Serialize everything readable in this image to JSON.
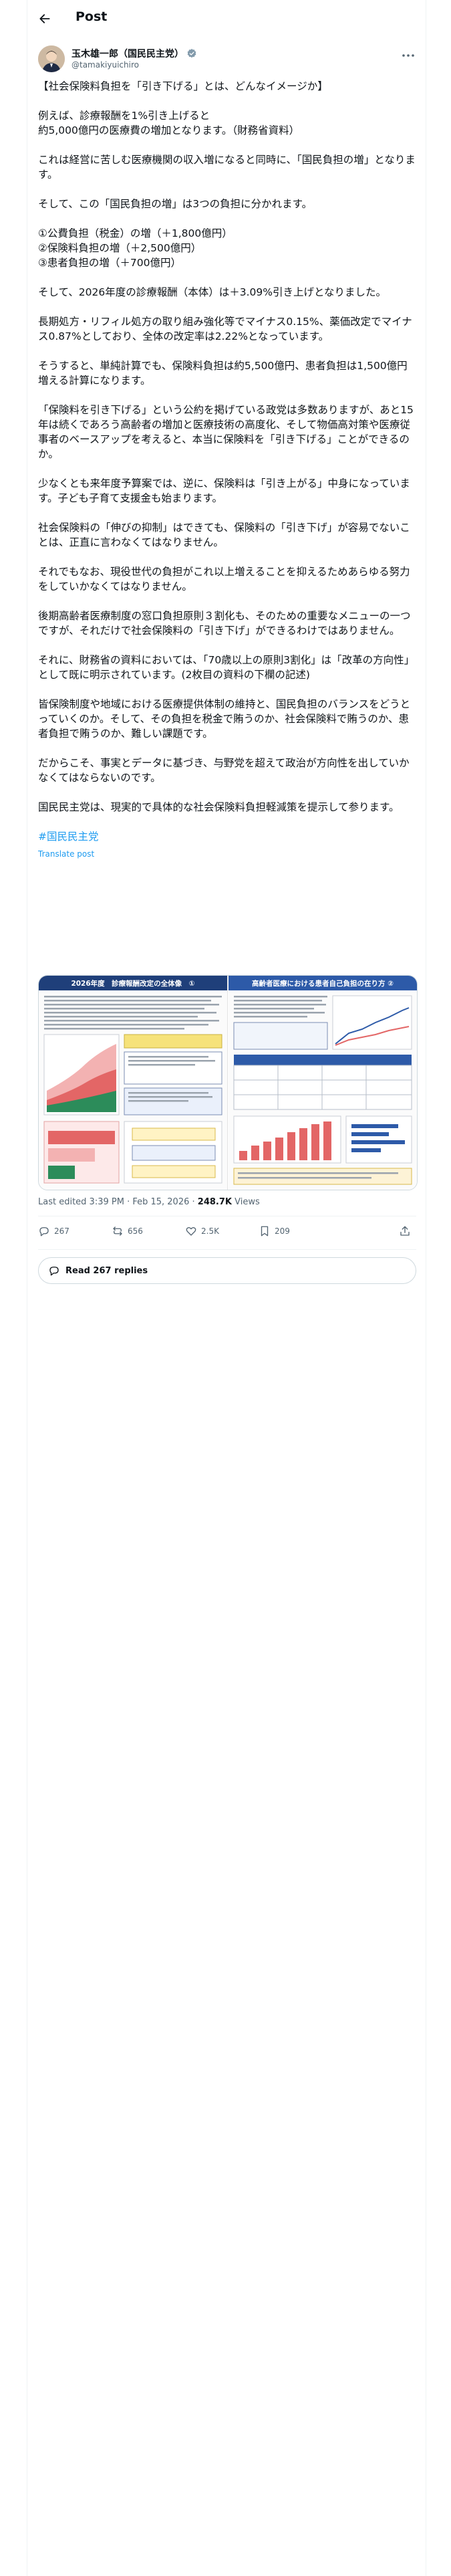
{
  "header": {
    "title": "Post"
  },
  "author": {
    "display_name": "玉木雄一郎（国民民主党）",
    "handle": "@tamakiyuichiro"
  },
  "post": {
    "paragraphs": [
      "【社会保険料負担を「引き下げる」とは、どんなイメージか】",
      "例えば、診療報酬を1%引き上げると\n約5,000億円の医療費の増加となります。（財務省資料）",
      "これは経営に苦しむ医療機関の収入増になると同時に、「国民負担の増」となります。",
      "そして、この「国民負担の増」は3つの負担に分かれます。",
      "①公費負担（税金）の増（＋1,800億円）\n②保険料負担の増（＋2,500億円）\n③患者負担の増（＋700億円）",
      "そして、2026年度の診療報酬（本体）は＋3.09%引き上げとなりました。",
      "長期処方・リフィル処方の取り組み強化等でマイナス0.15%、薬価改定でマイナス0.87%としており、全体の改定率は2.22%となっています。",
      "そうすると、単純計算でも、保険料負担は約5,500億円、患者負担は1,500億円増える計算になります。",
      "「保険料を引き下げる」という公約を掲げている政党は多数ありますが、あと15年は続くであろう高齢者の増加と医療技術の高度化、そして物価高対策や医療従事者のベースアップを考えると、本当に保険料を「引き下げる」ことができるのか。",
      "少なくとも来年度予算案では、逆に、保険料は「引き上がる」中身になっています。子ども子育て支援金も始まります。",
      "社会保険料の「伸びの抑制」はできても、保険料の「引き下げ」が容易でないことは、正直に言わなくてはなりません。",
      "それでもなお、現役世代の負担がこれ以上増えることを抑えるためあらゆる努力をしていかなくてはなりません。",
      "後期高齢者医療制度の窓口負担原則３割化も、そのための重要なメニューの一つですが、それだけで社会保険料の「引き下げ」ができるわけではありません。",
      "それに、財務省の資料においては、「70歳以上の原則3割化」は「改革の方向性」として既に明示されています。(2枚目の資料の下欄の記述)",
      "皆保険制度や地域における医療提供体制の維持と、国民負担のバランスをどうとっていくのか。そして、その負担を税金で賄うのか、社会保険料で賄うのか、患者負担で賄うのか、難しい課題です。",
      "だからこそ、事実とデータに基づき、与野党を超えて政治が方向性を出していかなくてはならないのです。",
      "国民民主党は、現実的で具体的な社会保険料負担軽減策を提示して参ります。"
    ],
    "hashtag": "#国民民主党",
    "translate": "Translate post"
  },
  "media": {
    "left_title": "2026年度　診療報酬改定の全体像　①",
    "right_title": "高齢者医療における患者自己負担の在り方 ②"
  },
  "meta": {
    "edited": "Last edited 3:39 PM · Feb 15, 2026 · ",
    "views_count": "248.7K",
    "views_label": " Views"
  },
  "actions": {
    "replies": "267",
    "reposts": "656",
    "likes": "2.5K",
    "bookmarks": "209"
  },
  "read_replies": "Read 267 replies",
  "colors": {
    "accent": "#1d9bf0",
    "text": "#0f1419",
    "muted": "#536471",
    "border": "#cfd9de"
  }
}
